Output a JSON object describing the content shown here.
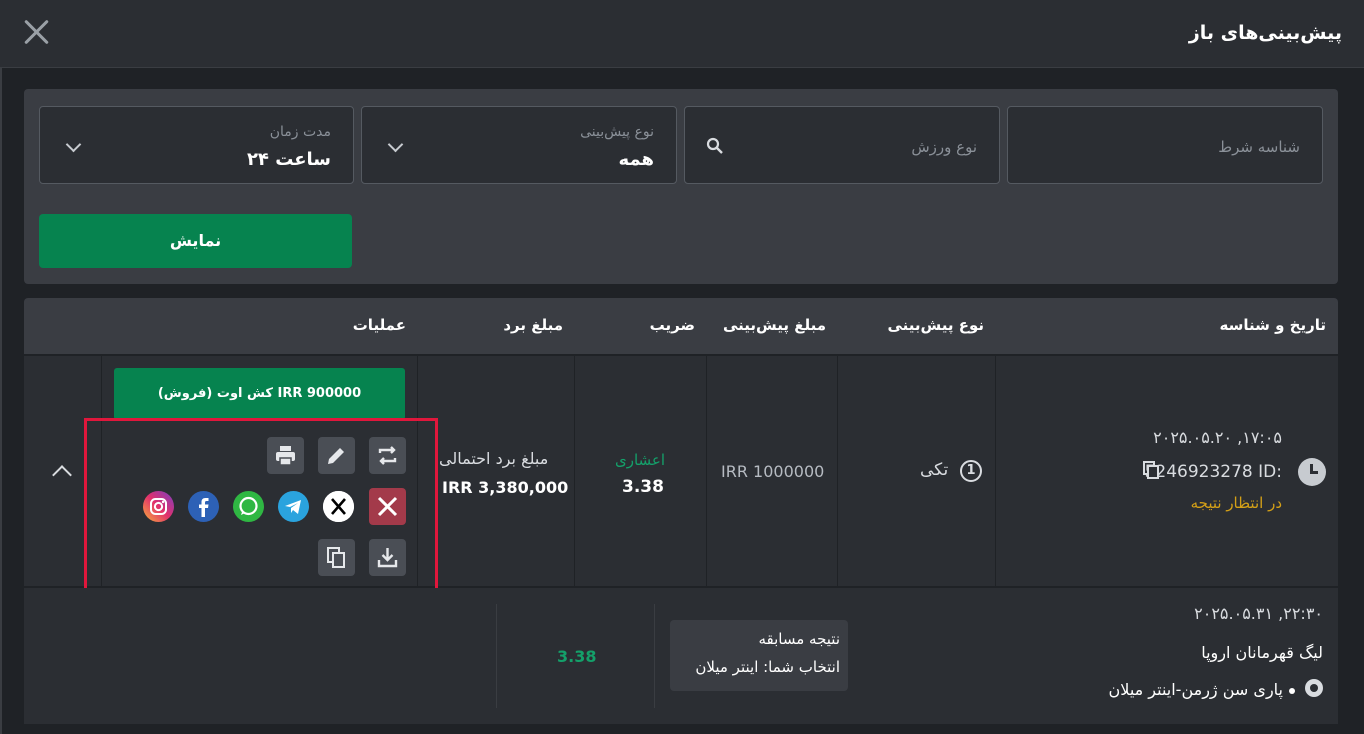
{
  "header": {
    "title": "پیش‌بینی‌های باز"
  },
  "filters": {
    "bet_id_placeholder": "شناسه شرط",
    "sport_placeholder": "نوع ورزش",
    "bet_type_label": "نوع پیش‌بینی",
    "bet_type_value": "همه",
    "period_label": "مدت زمان",
    "period_value": "۲۴ ساعت",
    "show_label": "نمایش"
  },
  "table": {
    "headers": {
      "date_id": "تاریخ و شناسه",
      "bet_type": "نوع پیش‌بینی",
      "stake": "مبلغ پیش‌بینی",
      "odds": "ضریب",
      "win": "مبلغ برد",
      "actions": "عملیات"
    },
    "row": {
      "date": "۲۰۲۵.۰۵.۲۰ ,۱۷:۰۵",
      "id_label": "ID:",
      "id_value": "5246923278",
      "status": "در انتظار نتیجه",
      "type_number": "1",
      "type_label": "تکی",
      "stake": "IRR 1000000",
      "odds_format": "اعشاری",
      "odds": "3.38",
      "possible_win_label": "مبلغ برد احتمالی",
      "possible_win": "IRR 3,380,000",
      "cashout_label": "کش اوت (فروش)  IRR 900000"
    },
    "detail": {
      "date": "۲۰۲۵.۰۵.۳۱ ,۲۲:۳۰",
      "league": "لیگ قهرمانان اروپا",
      "match": "پاری سن ژرمن-اینتر میلان",
      "market": "نتیجه مسابقه",
      "selection": "انتخاب شما: اینتر میلان",
      "odds": "3.38"
    }
  },
  "colors": {
    "accent": "#06834f",
    "pending": "#d4a017",
    "odds_green": "#14a06a",
    "highlight": "#e0173c",
    "cancel": "#a33a4a"
  },
  "icons": [
    "close-icon",
    "search-icon",
    "chevron-down-icon",
    "clock-icon",
    "copy-icon",
    "print-icon",
    "edit-icon",
    "repeat-icon",
    "cancel-icon",
    "x-icon",
    "telegram-icon",
    "whatsapp-icon",
    "facebook-icon",
    "instagram-icon",
    "download-icon",
    "chevron-up-icon",
    "soccer-ball-icon"
  ]
}
